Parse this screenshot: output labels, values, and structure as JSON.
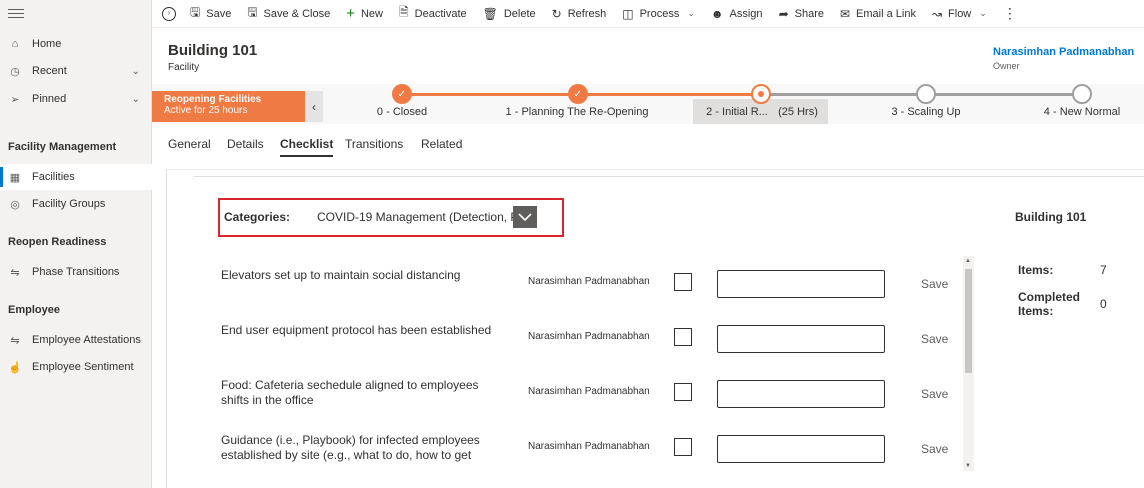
{
  "toolbar": {
    "save": "Save",
    "save_close": "Save & Close",
    "new": "New",
    "deactivate": "Deactivate",
    "delete": "Delete",
    "refresh": "Refresh",
    "process": "Process",
    "assign": "Assign",
    "share": "Share",
    "email_link": "Email a Link",
    "flow": "Flow"
  },
  "sidebar": {
    "top_items": [
      {
        "label": "Home",
        "icon": "home-icon"
      },
      {
        "label": "Recent",
        "icon": "clock-icon"
      },
      {
        "label": "Pinned",
        "icon": "pin-icon"
      }
    ],
    "sections": [
      {
        "title": "Facility Management",
        "items": [
          {
            "label": "Facilities",
            "icon": "facilities-icon",
            "active": true
          },
          {
            "label": "Facility Groups",
            "icon": "facility-groups-icon"
          }
        ]
      },
      {
        "title": "Reopen Readiness",
        "items": [
          {
            "label": "Phase Transitions",
            "icon": "transitions-icon"
          }
        ]
      },
      {
        "title": "Employee",
        "items": [
          {
            "label": "Employee Attestations",
            "icon": "attestations-icon"
          },
          {
            "label": "Employee Sentiment",
            "icon": "thumbs-up-icon"
          }
        ]
      }
    ]
  },
  "record": {
    "title": "Building 101",
    "entity": "Facility",
    "owner_name": "Narasimhan Padmanabhan",
    "owner_label": "Owner"
  },
  "bpf": {
    "process_name": "Reopening Facilities",
    "active_for": "Active for 25 hours",
    "stages": [
      {
        "label": "0 - Closed",
        "status": "done"
      },
      {
        "label": "1 - Planning The Re-Opening",
        "status": "done"
      },
      {
        "label": "2 - Initial R...",
        "duration": "(25 Hrs)",
        "status": "active"
      },
      {
        "label": "3 - Scaling Up",
        "status": "todo"
      },
      {
        "label": "4 - New Normal",
        "status": "todo"
      }
    ]
  },
  "tabs": [
    "General",
    "Details",
    "Checklist",
    "Transitions",
    "Related"
  ],
  "selected_tab": "Checklist",
  "checklist": {
    "categories_label": "Categories:",
    "categories_value": "COVID-19 Management (Detection, P",
    "rows": [
      {
        "task": "Elevators set up to maintain social distancing",
        "owner": "Narasimhan Padmanabhan",
        "save": "Save"
      },
      {
        "task": "End user equipment protocol has been established",
        "owner": "Narasimhan Padmanabhan",
        "save": "Save"
      },
      {
        "task": "Food: Cafeteria sechedule aligned to employees shifts in the office",
        "owner": "Narasimhan Padmanabhan",
        "save": "Save"
      },
      {
        "task": "Guidance (i.e., Playbook) for infected employees established by site (e.g., what to do, how to get",
        "owner": "Narasimhan Padmanabhan",
        "save": "Save"
      }
    ],
    "summary_title": "Building 101",
    "items_label": "Items:",
    "items_value": "7",
    "completed_label": "Completed Items:",
    "completed_value": "0"
  },
  "colors": {
    "accent": "#0078d4",
    "bpf_orange": "#ef7a43",
    "highlight_red": "#d9262e"
  }
}
